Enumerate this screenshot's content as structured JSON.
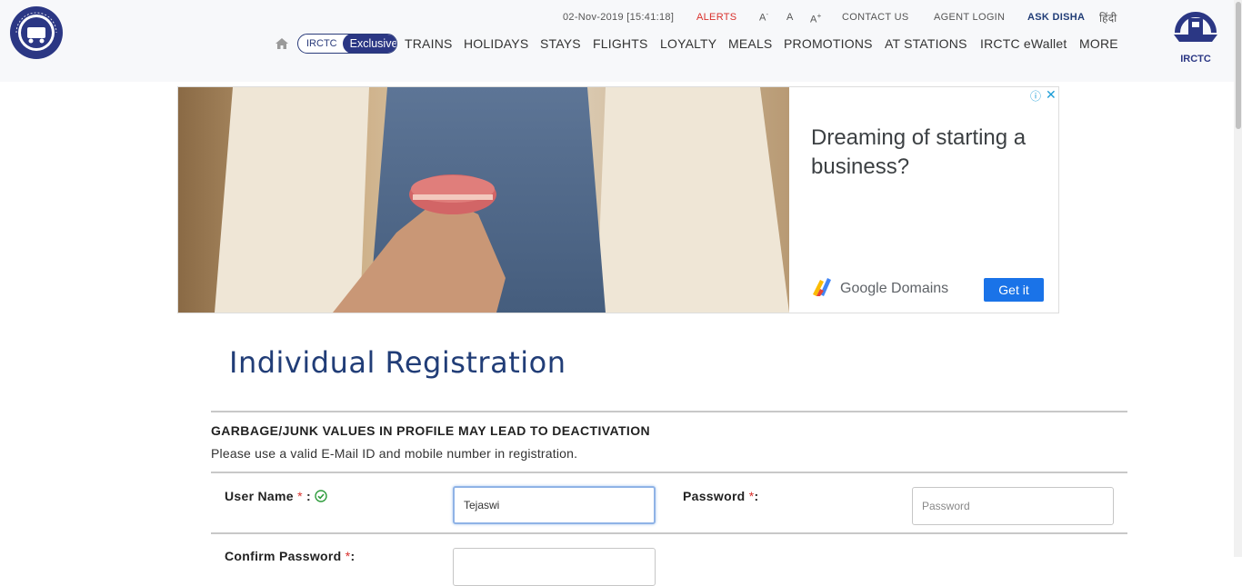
{
  "header": {
    "datetime": "02-Nov-2019 [15:41:18]",
    "alerts": "ALERTS",
    "font_small": "A",
    "font_small_sup": "-",
    "font_normal": "A",
    "font_large": "A",
    "font_large_sup": "+",
    "contact_us": "CONTACT US",
    "agent_login": "AGENT LOGIN",
    "ask_disha": "ASK DISHA",
    "hindi": "हिंदी",
    "right_logo_text": "IRCTC",
    "left_logo_text": "INDIAN RAILWAYS"
  },
  "nav": {
    "pill_irctc": "IRCTC",
    "pill_exclusive": "Exclusive",
    "items": [
      "TRAINS",
      "HOLIDAYS",
      "STAYS",
      "FLIGHTS",
      "LOYALTY",
      "MEALS",
      "PROMOTIONS",
      "AT STATIONS",
      "IRCTC eWallet",
      "MORE"
    ]
  },
  "ad": {
    "headline": "Dreaming of starting a business?",
    "brand": "Google Domains",
    "cta": "Get it"
  },
  "form": {
    "title": "Individual Registration",
    "warning": "GARBAGE/JUNK VALUES IN PROFILE MAY LEAD TO DEACTIVATION",
    "note": "Please use a valid E-Mail ID and mobile number in registration.",
    "username_label": "User Name",
    "username_value": "Tejaswi",
    "password_label": "Password",
    "password_placeholder": "Password",
    "confirm_label": "Confirm Password",
    "required_mark": "*",
    "colon": ":"
  },
  "colors": {
    "brand_blue": "#213d77",
    "alert_red": "#d9302c",
    "ad_blue": "#1a73e8",
    "valid_green": "#2e9c3c"
  }
}
